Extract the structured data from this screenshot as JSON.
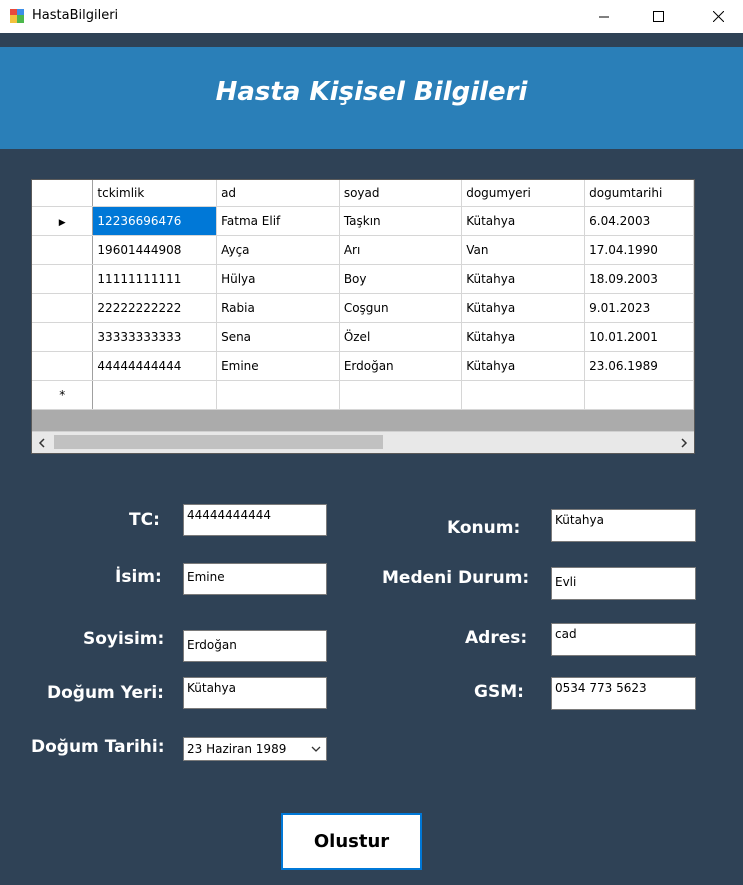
{
  "window": {
    "title": "HastaBilgileri"
  },
  "header": {
    "title": "Hasta Kişisel Bilgileri"
  },
  "grid": {
    "columns": [
      "tckimlik",
      "ad",
      "soyad",
      "dogumyeri",
      "dogumtarihi"
    ],
    "rows": [
      [
        "12236696476",
        "Fatma Elif",
        "Taşkın",
        "Kütahya",
        "6.04.2003"
      ],
      [
        "19601444908",
        "Ayça",
        "Arı",
        "Van",
        "17.04.1990"
      ],
      [
        "11111111111",
        "Hülya",
        "Boy",
        "Kütahya",
        "18.09.2003"
      ],
      [
        "22222222222",
        "Rabia",
        "Coşgun",
        "Kütahya",
        "9.01.2023"
      ],
      [
        "33333333333",
        "Sena",
        "Özel",
        "Kütahya",
        "10.01.2001"
      ],
      [
        "44444444444",
        "Emine",
        "Erdoğan",
        "Kütahya",
        "23.06.1989"
      ]
    ],
    "current_row_marker": "▶",
    "new_row_marker": "*"
  },
  "form": {
    "tc_label": "TC:",
    "tc_value": "44444444444",
    "isim_label": "İsim:",
    "isim_value": "Emine",
    "soyisim_label": "Soyisim:",
    "soyisim_value": "Erdoğan",
    "dogumyeri_label": "Doğum Yeri:",
    "dogumyeri_value": "Kütahya",
    "dogumtarihi_label": "Doğum Tarihi:",
    "dogumtarihi_value": "23  Haziran  1989",
    "konum_label": "Konum:",
    "konum_value": "Kütahya",
    "medeni_label": "Medeni Durum:",
    "medeni_value": "Evli",
    "adres_label": "Adres:",
    "adres_value": "cad",
    "gsm_label": "GSM:",
    "gsm_value": "0534 773 5623"
  },
  "actions": {
    "create_label": "Olustur"
  },
  "colors": {
    "background": "#2f4256",
    "header": "#2a7fb8",
    "selection": "#0078d7"
  }
}
